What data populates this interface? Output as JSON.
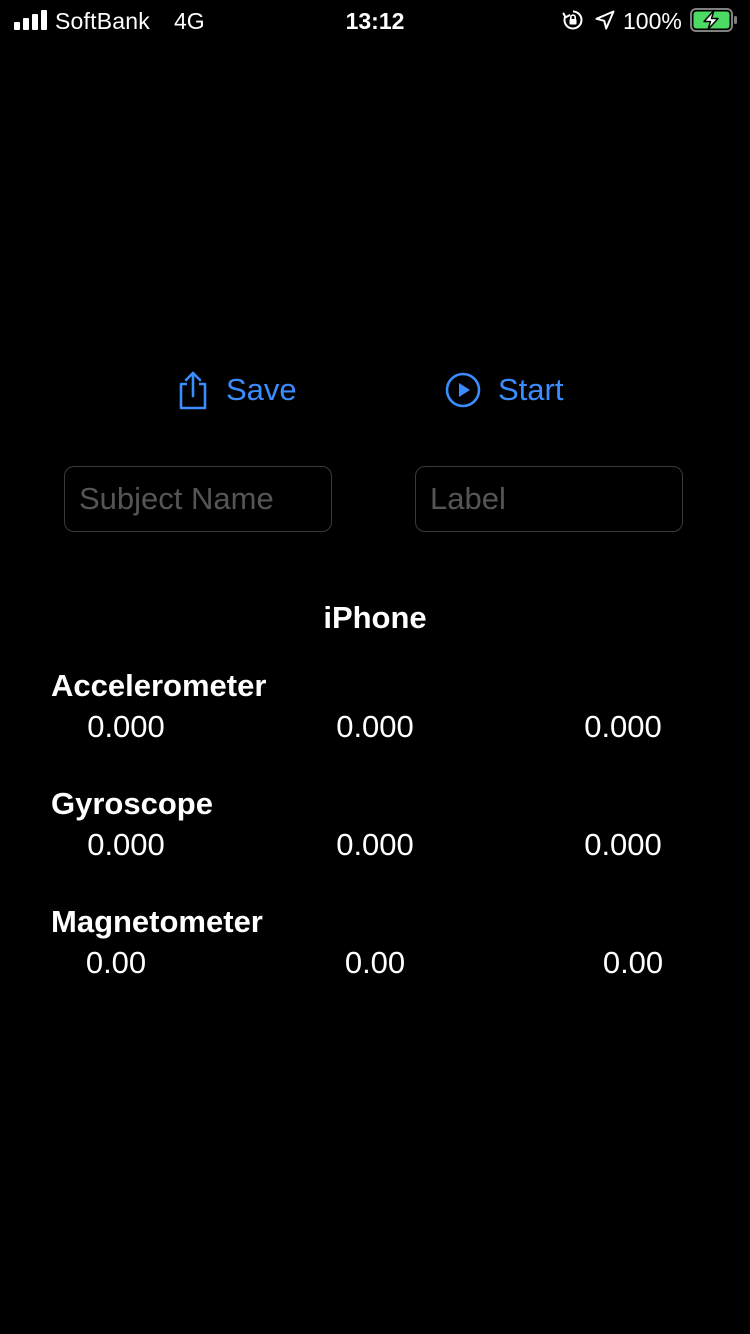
{
  "status_bar": {
    "carrier": "SoftBank",
    "network": "4G",
    "time": "13:12",
    "battery_percent": "100%",
    "icons": [
      "signal-bars-icon",
      "orientation-lock-icon",
      "location-arrow-icon",
      "battery-charging-icon"
    ]
  },
  "actions": {
    "save_label": "Save",
    "start_label": "Start",
    "accent_color": "#3a8cff"
  },
  "fields": {
    "subject_placeholder": "Subject Name",
    "subject_value": "",
    "label_placeholder": "Label",
    "label_value": ""
  },
  "device": {
    "title": "iPhone"
  },
  "sensors": {
    "accelerometer": {
      "title": "Accelerometer",
      "values": [
        "0.000",
        "0.000",
        "0.000"
      ]
    },
    "gyroscope": {
      "title": "Gyroscope",
      "values": [
        "0.000",
        "0.000",
        "0.000"
      ]
    },
    "magnetometer": {
      "title": "Magnetometer",
      "values": [
        "0.00",
        "0.00",
        "0.00"
      ]
    }
  }
}
